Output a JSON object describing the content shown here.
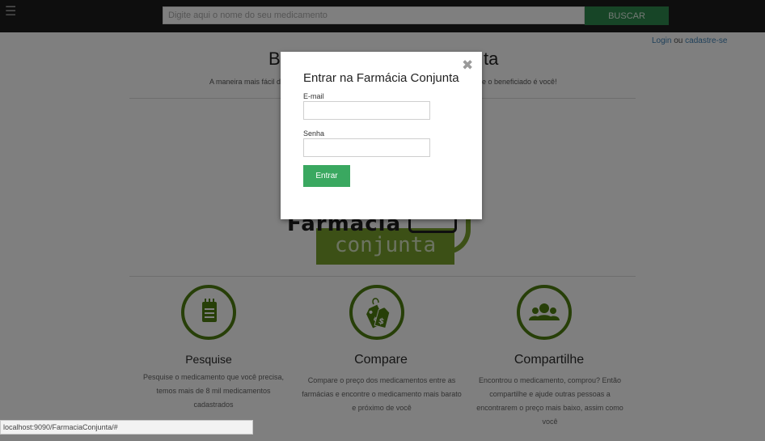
{
  "header": {
    "menu_icon": "hamburger-icon",
    "search_placeholder": "Digite aqui o nome do seu medicamento",
    "search_button": "BUSCAR",
    "login": "Login",
    "or": " ou ",
    "register": "cadastre-se"
  },
  "hero": {
    "title_left": "B",
    "title_right": "ta",
    "subtitle_left": "A maneira mais fácil de",
    "subtitle_right": "e o beneficiado é você!"
  },
  "logo": {
    "word1": "Farmacia",
    "word2": "conjunta"
  },
  "features": [
    {
      "icon": "notepad-icon",
      "title": "Pesquise",
      "description": "Pesquise o medicamento que você precisa, temos mais de 8 mil medicamentos cadastrados"
    },
    {
      "icon": "price-tags-icon",
      "title": "Compare",
      "description": "Compare o preço dos medicamentos entre as farmácias e encontre o medicamento mais barato e próximo de você"
    },
    {
      "icon": "group-people-icon",
      "title": "Compartilhe",
      "description": "Encontrou o medicamento, comprou? Então compartilhe e ajude outras pessoas a encontrarem o preço mais baixo, assim como você"
    }
  ],
  "modal": {
    "close_icon": "close-icon",
    "title": "Entrar na Farmácia Conjunta",
    "email_label": "E-mail",
    "password_label": "Senha",
    "submit": "Entrar"
  },
  "status_bar": {
    "url": "localhost:9090/FarmaciaConjunta/#"
  },
  "colors": {
    "topbar": "#1c1c1c",
    "search_button": "#2e8b4f",
    "brand_green": "#78a02d",
    "icon_green": "#4f7f11",
    "enter_button": "#3aa860",
    "link": "#3f80b5"
  }
}
